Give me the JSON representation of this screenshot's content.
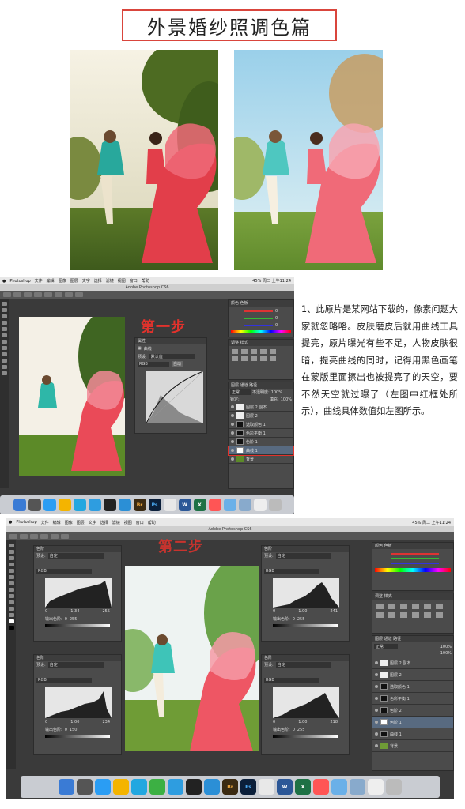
{
  "title": "外景婚纱照调色篇",
  "screenshot1": {
    "menu_items": [
      "Photoshop",
      "文件",
      "编辑",
      "图像",
      "图层",
      "文字",
      "选择",
      "滤镜",
      "视图",
      "窗口",
      "帮助"
    ],
    "status_right": "45% 周二 上午11:24",
    "window_title": "Adobe Photoshop CS6",
    "step_label": "第一步",
    "panel_title": "属性",
    "curves_label": "曲线",
    "preset_label": "预设:",
    "preset_value": "默认值",
    "channel_value": "RGB",
    "auto_label": "自动",
    "layer_selected": "曲线 1",
    "opacity_label": "不透明度:",
    "opacity_value": "100%",
    "fill_label": "填充:",
    "fill_value": "100%",
    "lock_label": "锁定:",
    "blend_mode": "正常",
    "layers": [
      "图层 2 副本",
      "图层 2",
      "选取颜色 1",
      "色彩平衡 1",
      "色阶 1",
      "曲线 1",
      "背景"
    ],
    "rgb_values": [
      "0",
      "0",
      "0"
    ],
    "dock_labels": [
      "Br",
      "Ps",
      "W",
      "X"
    ]
  },
  "description": "1、此原片是某网站下载的，像素问题大家就忽略咯。皮肤磨皮后就用曲线工具提亮，原片曝光有些不足，人物皮肤很暗，提亮曲线的同时，记得用黑色画笔在蒙版里面擦出也被提亮了的天空，要不然天空就过曝了（左图中红框处所示），曲线具体数值如左图所示。",
  "screenshot2": {
    "menu_items": [
      "Photoshop",
      "文件",
      "编辑",
      "图像",
      "图层",
      "文字",
      "选择",
      "滤镜",
      "视图",
      "窗口",
      "帮助"
    ],
    "status_right": "45% 周二 上午11:24",
    "window_title": "Adobe Photoshop CS6",
    "step_label": "第二步",
    "levels_label": "色阶",
    "preset_label": "预设:",
    "preset_value": "自定",
    "channel_value": "RGB",
    "output_label": "输出色阶:",
    "levels_panels": [
      {
        "in_black": "0",
        "gamma": "1.34",
        "in_white": "255",
        "out_black": "0",
        "out_white": "255"
      },
      {
        "in_black": "0",
        "gamma": "1.00",
        "in_white": "234",
        "out_black": "0",
        "out_white": "150"
      },
      {
        "in_black": "0",
        "gamma": "1.00",
        "in_white": "241",
        "out_black": "0",
        "out_white": "255"
      },
      {
        "in_black": "0",
        "gamma": "1.00",
        "in_white": "218",
        "out_black": "0",
        "out_white": "255"
      }
    ],
    "layer_selected": "色阶 1",
    "layers": [
      "图层 2 副本",
      "图层 2",
      "选取颜色 1",
      "色彩平衡 1",
      "色阶 2",
      "色阶 1",
      "曲线 1",
      "背景"
    ],
    "opacity_value": "100%",
    "fill_value": "100%",
    "blend_mode": "正常",
    "dock_labels": [
      "Br",
      "Ps",
      "W",
      "X"
    ]
  }
}
